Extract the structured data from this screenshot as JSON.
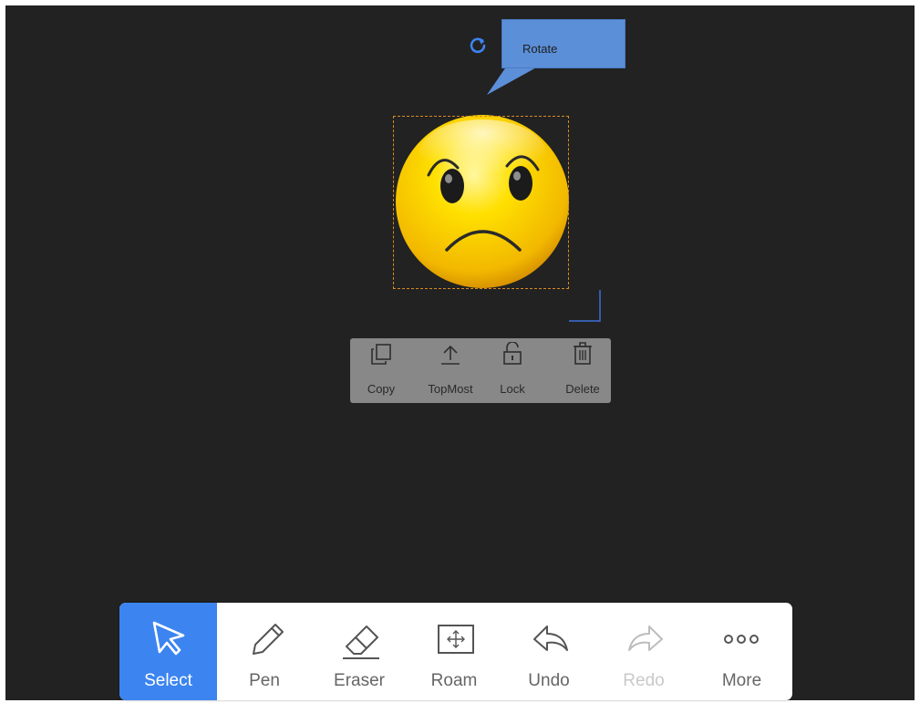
{
  "tooltip": {
    "text": "Rotate"
  },
  "context_menu": {
    "items": [
      {
        "label": "Copy",
        "icon": "copy-icon"
      },
      {
        "label": "TopMost",
        "icon": "upload-icon"
      },
      {
        "label": "Lock",
        "icon": "unlock-icon"
      },
      {
        "label": "Delete",
        "icon": "trash-icon"
      }
    ]
  },
  "toolbar": {
    "tools": [
      {
        "label": "Select",
        "icon": "cursor-arrow-icon",
        "state": "active"
      },
      {
        "label": "Pen",
        "icon": "pen-icon",
        "state": "normal"
      },
      {
        "label": "Eraser",
        "icon": "eraser-icon",
        "state": "normal"
      },
      {
        "label": "Roam",
        "icon": "move-icon",
        "state": "normal"
      },
      {
        "label": "Undo",
        "icon": "undo-icon",
        "state": "normal"
      },
      {
        "label": "Redo",
        "icon": "redo-icon",
        "state": "disabled"
      },
      {
        "label": "More",
        "icon": "more-dots-icon",
        "state": "normal"
      }
    ]
  },
  "colors": {
    "canvas_bg": "#222222",
    "accent": "#3c84f0",
    "tooltip_bg": "#5b8fd8",
    "selection_border": "#d78a22",
    "menu_bg": "#888888"
  }
}
